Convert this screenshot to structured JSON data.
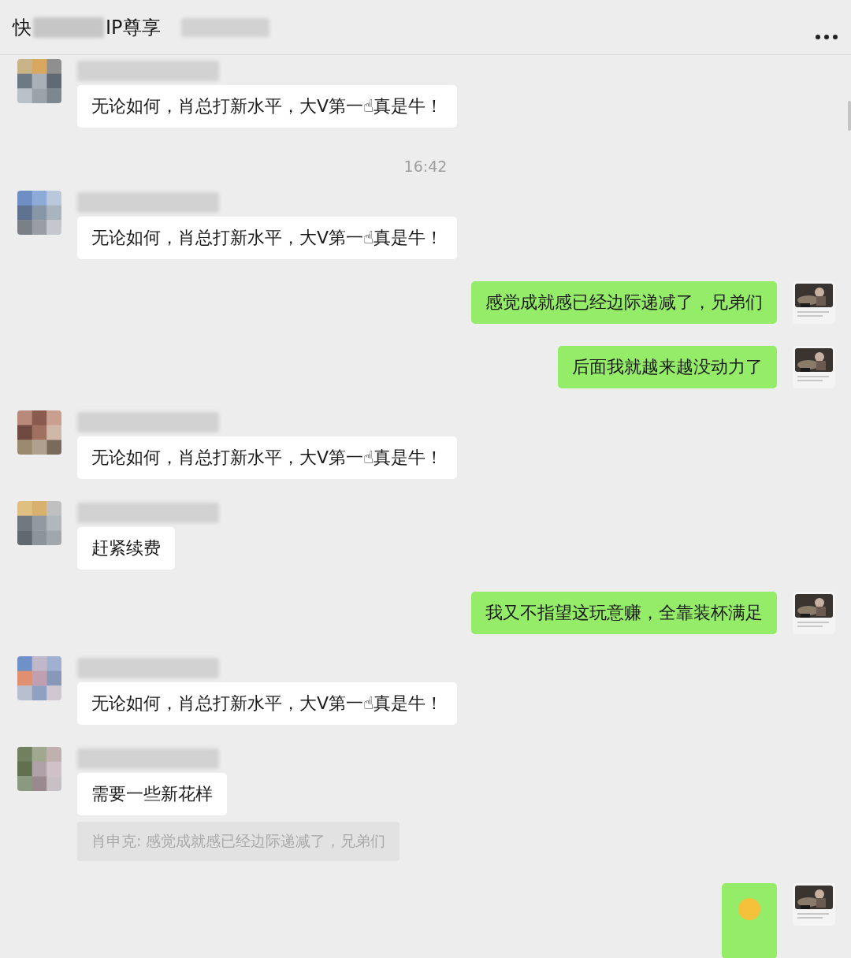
{
  "header": {
    "title_start": "快",
    "title_end": "IP尊享"
  },
  "messages": [
    {
      "kind": "received",
      "text": "无论如何，肖总打新水平，大V第一☝真是牛！"
    },
    {
      "kind": "time",
      "text": "16:42"
    },
    {
      "kind": "received",
      "text": "无论如何，肖总打新水平，大V第一☝真是牛！"
    },
    {
      "kind": "sent",
      "text": "感觉成就感已经边际递减了，兄弟们"
    },
    {
      "kind": "sent",
      "text": "后面我就越来越没动力了"
    },
    {
      "kind": "received",
      "text": "无论如何，肖总打新水平，大V第一☝真是牛！"
    },
    {
      "kind": "received",
      "text": "赶紧续费"
    },
    {
      "kind": "sent",
      "text": "我又不指望这玩意赚，全靠装杯满足"
    },
    {
      "kind": "received",
      "text": "无论如何，肖总打新水平，大V第一☝真是牛！"
    },
    {
      "kind": "received",
      "text": "需要一些新花样"
    },
    {
      "kind": "quote",
      "text": "肖申克: 感觉成就感已经边际递减了，兄弟们"
    },
    {
      "kind": "sticker"
    }
  ]
}
